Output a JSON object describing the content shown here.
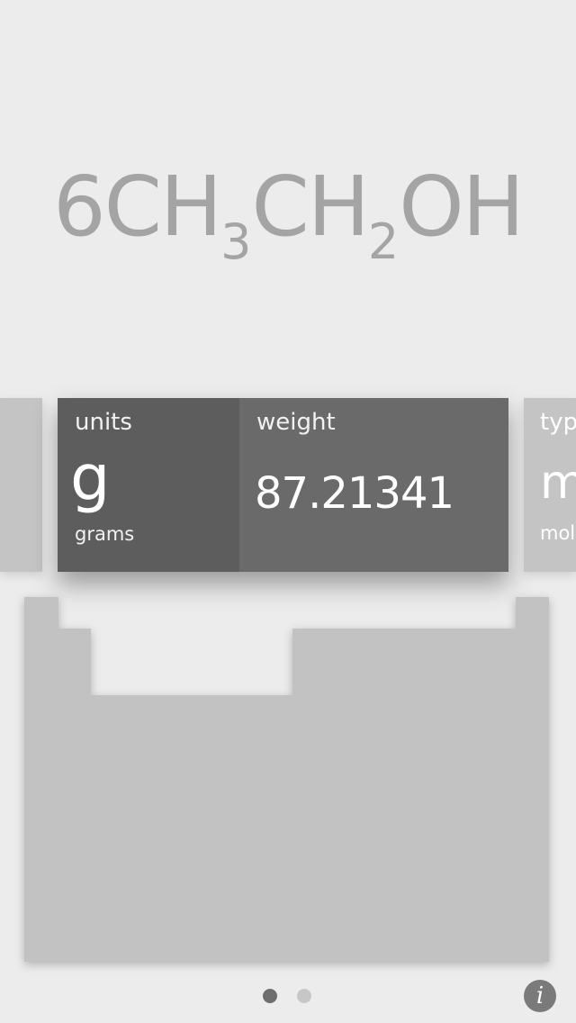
{
  "formula": {
    "segments": [
      {
        "text": "6CH",
        "sub": false
      },
      {
        "text": "3",
        "sub": true
      },
      {
        "text": "CH",
        "sub": false
      },
      {
        "text": "2",
        "sub": true
      },
      {
        "text": "OH",
        "sub": false
      }
    ]
  },
  "card": {
    "units_label": "units",
    "unit_symbol": "g",
    "unit_name": "grams",
    "weight_label": "weight",
    "weight_value": "87.21341"
  },
  "next_card": {
    "label": "typ",
    "symbol": "m",
    "name": "mole"
  },
  "pager": {
    "page_count": 2,
    "active_page": 1
  },
  "info_button": {
    "glyph": "i"
  },
  "colors": {
    "background": "#ececec",
    "formula_text": "#a4a4a4",
    "card_bg": "#6a6a6a",
    "units_pane_bg": "#5d5d5d",
    "side_card_bg": "#c4c4c4",
    "table_bg": "#c2c2c2",
    "dot_active": "#6e6e6e",
    "dot_inactive": "#c7c7c7"
  },
  "icons": {
    "info": "info-icon"
  }
}
